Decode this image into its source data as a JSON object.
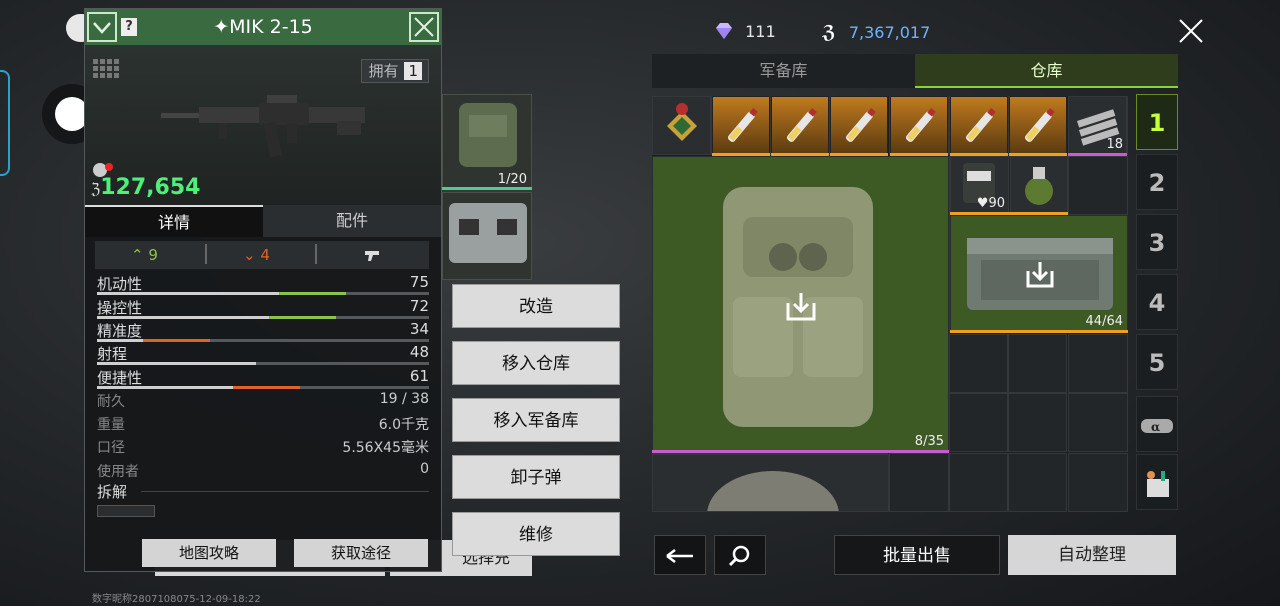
{
  "panel": {
    "title": "MIK 2-15",
    "owned_label": "拥有",
    "owned_count": "1",
    "price": "127,654",
    "tabs": {
      "details": "详情",
      "attachments": "配件"
    },
    "upgrades": {
      "up": "9",
      "down": "4"
    },
    "stats": [
      {
        "label": "机动性",
        "value": "75",
        "fill": 0.75,
        "color": "#8bc34a"
      },
      {
        "label": "操控性",
        "value": "72",
        "fill": 0.72,
        "color": "#8bc34a"
      },
      {
        "label": "精准度",
        "value": "34",
        "fill": 0.34,
        "color": "#e0622a"
      },
      {
        "label": "射程",
        "value": "48",
        "fill": 0.48,
        "color": "#cfcfcf"
      },
      {
        "label": "便捷性",
        "value": "61",
        "fill": 0.61,
        "color": "#e0622a"
      }
    ],
    "info": [
      {
        "label": "耐久",
        "value": "19 / 38"
      },
      {
        "label": "重量",
        "value": "6.0千克"
      },
      {
        "label": "口径",
        "value": "5.56X45毫米"
      },
      {
        "label": "使用者",
        "value": "0"
      }
    ],
    "disassemble": "拆解",
    "btn_map": "地图攻略",
    "btn_source": "获取途径"
  },
  "context_menu": [
    "改造",
    "移入仓库",
    "移入军备库",
    "卸子弹",
    "维修"
  ],
  "behind": {
    "count_1": "1/20",
    "btn_label": "选择充"
  },
  "currency": {
    "diamonds": "111",
    "coins": "7,367,017"
  },
  "storage_tabs": {
    "armory": "军备库",
    "warehouse": "仓库"
  },
  "grid": {
    "ammo_count": "18",
    "medkit_count": "90",
    "backpack_count": "8/35",
    "case_count": "44/64"
  },
  "side_tabs": [
    "1",
    "2",
    "3",
    "4",
    "5"
  ],
  "bottom": {
    "bulk_sell": "批量出售",
    "auto_sort": "自动整理"
  },
  "footer": "数字昵称2807108075-12-09-18:22"
}
